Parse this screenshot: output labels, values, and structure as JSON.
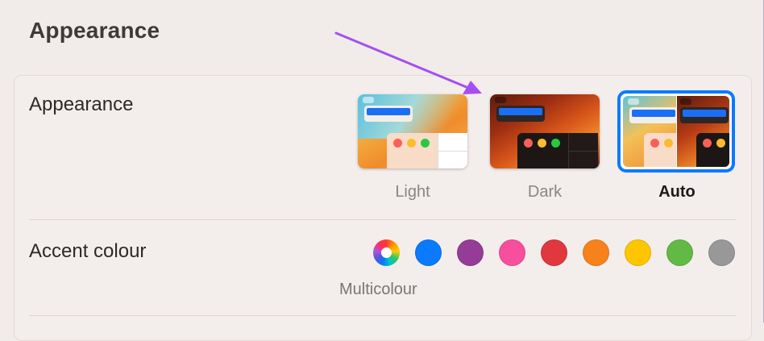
{
  "page": {
    "title": "Appearance"
  },
  "appearance": {
    "label": "Appearance",
    "options": [
      {
        "label": "Light",
        "selected": false
      },
      {
        "label": "Dark",
        "selected": false
      },
      {
        "label": "Auto",
        "selected": true
      }
    ],
    "selection_color": "#0a7aff"
  },
  "accent": {
    "label": "Accent colour",
    "selected_caption": "Multicolour",
    "swatches": [
      {
        "name": "multicolour",
        "color": "multi"
      },
      {
        "name": "blue",
        "color": "#0a7aff"
      },
      {
        "name": "purple",
        "color": "#953d96"
      },
      {
        "name": "pink",
        "color": "#f74f9e"
      },
      {
        "name": "red",
        "color": "#e0383e"
      },
      {
        "name": "orange",
        "color": "#f7821b"
      },
      {
        "name": "yellow",
        "color": "#ffc600"
      },
      {
        "name": "green",
        "color": "#62ba46"
      },
      {
        "name": "graphite",
        "color": "#989898"
      }
    ]
  },
  "annotation": {
    "arrow_color": "#a64ff0"
  }
}
